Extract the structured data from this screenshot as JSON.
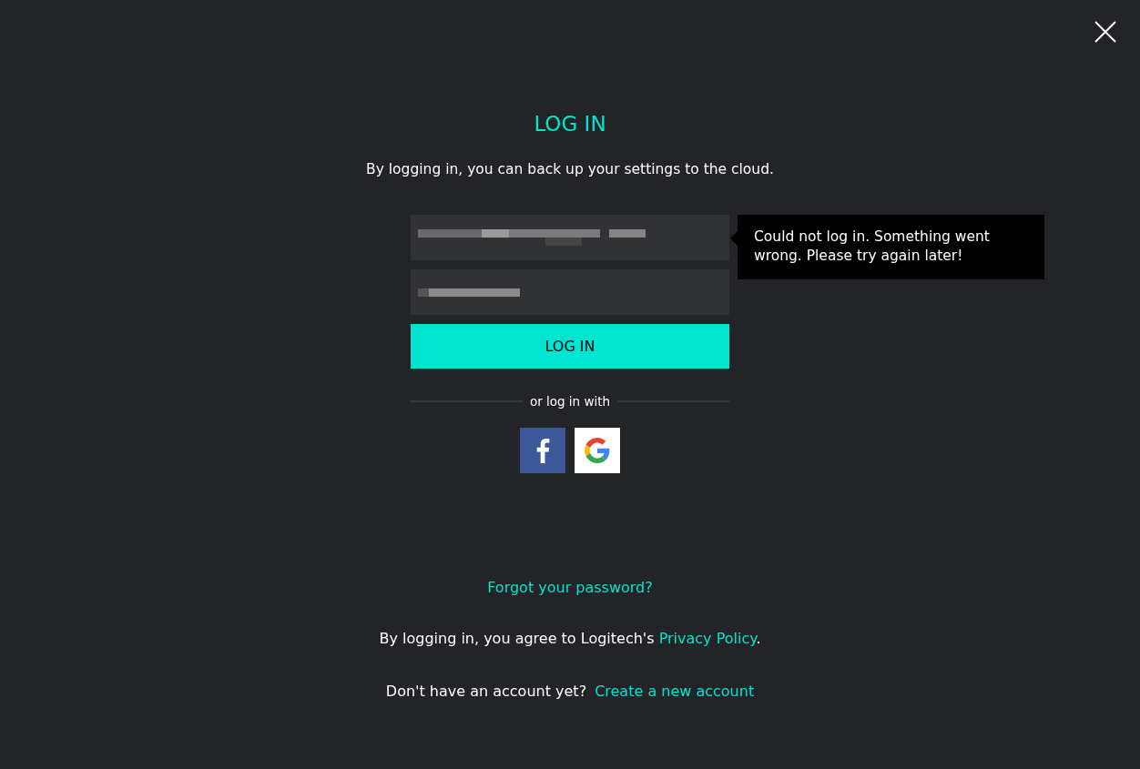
{
  "title": "LOG IN",
  "subtitle": "By logging in, you can back up your settings to the cloud.",
  "error_tooltip": "Could not log in. Something went wrong. Please try again later!",
  "login_button": "LOG IN",
  "divider_text": "or log in with",
  "social_buttons": [
    {
      "kind": "facebook"
    },
    {
      "kind": "google"
    }
  ],
  "forgot_link": "Forgot your password?",
  "privacy": {
    "text": "By logging in, you agree to Logitech's ",
    "link": "Privacy Policy",
    "after": "."
  },
  "signup": {
    "text": "Don't have an account yet?",
    "link": "Create a new account"
  }
}
